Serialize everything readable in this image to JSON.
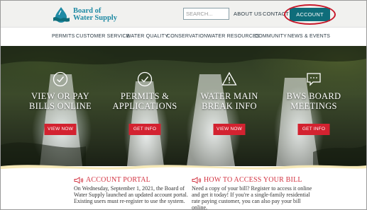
{
  "header": {
    "logo_line1": "Board of",
    "logo_line2": "Water Supply",
    "search_placeholder": "SEARCH...",
    "about_label": "ABOUT US",
    "contact_label": "CONTACT",
    "account_label": "ACCOUNT"
  },
  "nav": {
    "items": [
      "PERMITS",
      "CUSTOMER SERVICE",
      "WATER QUALITY",
      "CONSERVATION",
      "WATER RESOURCES",
      "COMMUNITY",
      "NEWS & EVENTS"
    ]
  },
  "hero": {
    "panels": [
      {
        "line1": "VIEW OR PAY",
        "line2": "BILLS ONLINE",
        "button": "VIEW NOW",
        "icon": "check-circle-icon"
      },
      {
        "line1": "PERMITS &",
        "line2": "APPLICATIONS",
        "button": "GET INFO",
        "icon": "check-circle-icon"
      },
      {
        "line1": "WATER MAIN",
        "line2": "BREAK INFO",
        "button": "VIEW NOW",
        "icon": "warning-triangle-icon"
      },
      {
        "line1": "BWS BOARD",
        "line2": "MEETINGS",
        "button": "GET INFO",
        "icon": "chat-bubble-icon"
      }
    ]
  },
  "news": {
    "left": {
      "title": "ACCOUNT PORTAL",
      "body": "On Wednesday, September 1, 2021, the Board of Water Supply launched an updated account portal. Existing users must re-register to use the system."
    },
    "right": {
      "title": "HOW TO ACCESS YOUR BILL",
      "body": "Need a copy of your bill? Register to access it online and get it today! If you're a single-family residential rate paying customer, you can also pay your bill online."
    }
  },
  "colors": {
    "brand": "#1f8aa4",
    "account_button": "#0f6d7a",
    "highlight_ring": "#c8192b",
    "cta_button": "#d32230",
    "news_heading": "#d23240"
  }
}
